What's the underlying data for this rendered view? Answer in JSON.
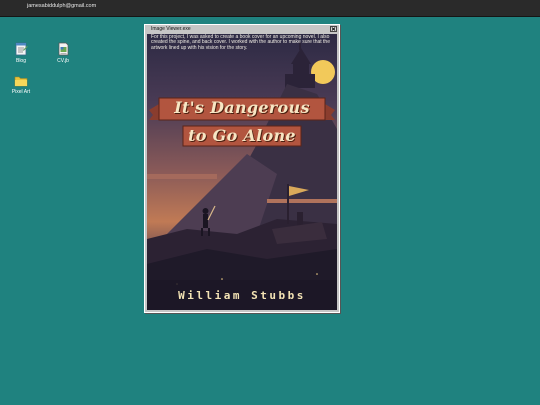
{
  "topbar": {
    "email": "jamesabiddulph@gmail.com"
  },
  "desktop": {
    "icons": [
      {
        "label": "Blog",
        "icon": "notepad-icon"
      },
      {
        "label": "CV.jb",
        "icon": "document-icon"
      },
      {
        "label": "Pixel Art",
        "icon": "folder-icon"
      }
    ]
  },
  "window": {
    "title": "Image Viewer.exe",
    "description": "For this project, I was asked to create a book cover for an upcoming novel. I also created the spine, and back cover. I worked with the author to make sure that the artwork lined up with his vision for the story.",
    "cover": {
      "title_line1": "It's Dangerous",
      "title_line2": "to Go Alone",
      "author": "William Stubbs"
    }
  },
  "colors": {
    "desktop": "#1f827f",
    "taskbar": "#2a2a2a",
    "window": "#c6c6c6",
    "cover_banner": "#b2553f",
    "cover_text": "#f7e6c4"
  }
}
